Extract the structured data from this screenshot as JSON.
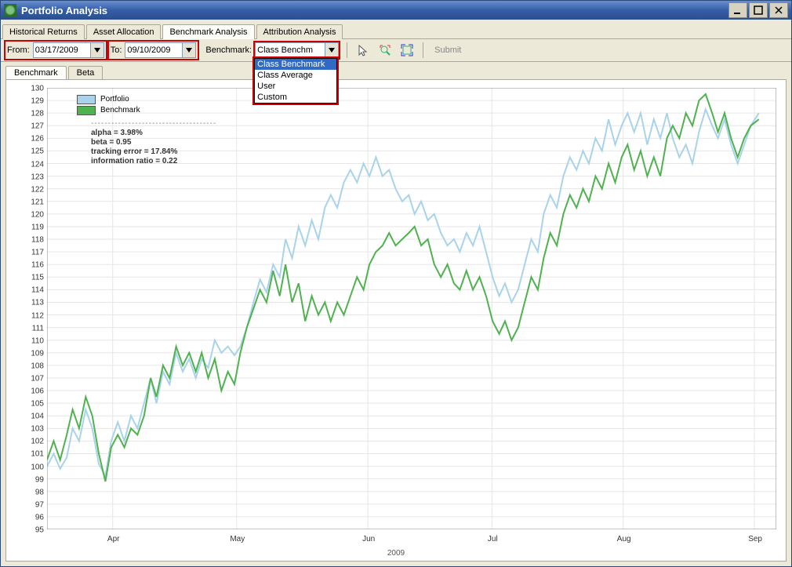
{
  "window": {
    "title": "Portfolio Analysis"
  },
  "tabs": {
    "items": [
      {
        "label": "Historical Returns"
      },
      {
        "label": "Asset Allocation"
      },
      {
        "label": "Benchmark Analysis"
      },
      {
        "label": "Attribution Analysis"
      }
    ],
    "active": 2
  },
  "toolbar": {
    "from_label": "From:",
    "from_value": "03/17/2009",
    "to_label": "To:",
    "to_value": "09/10/2009",
    "benchmark_label": "Benchmark:",
    "benchmark_value": "Class Benchm",
    "benchmark_options": [
      "Class Benchmark",
      "Class Average",
      "User",
      "Custom"
    ],
    "submit_label": "Submit"
  },
  "subtabs": {
    "items": [
      {
        "label": "Benchmark"
      },
      {
        "label": "Beta"
      }
    ],
    "active": 0
  },
  "legend": {
    "portfolio": {
      "label": "Portfolio",
      "color": "#a9d3ea"
    },
    "benchmark": {
      "label": "Benchmark",
      "color": "#4fb24f"
    }
  },
  "stats": {
    "lines": [
      "alpha = 3.98%",
      "beta = 0.95",
      "tracking error = 17.84%",
      "information ratio = 0.22"
    ]
  },
  "chart_data": {
    "type": "line",
    "title": "",
    "xlabel": "2009",
    "ylabel": "",
    "ylim": [
      95,
      130
    ],
    "yticks": [
      95,
      96,
      97,
      98,
      99,
      100,
      101,
      102,
      103,
      104,
      105,
      106,
      107,
      108,
      109,
      110,
      111,
      112,
      113,
      114,
      115,
      116,
      117,
      118,
      119,
      120,
      121,
      122,
      123,
      124,
      125,
      126,
      127,
      128,
      129,
      130
    ],
    "x_categories": [
      "Apr",
      "May",
      "Jun",
      "Jul",
      "Aug",
      "Sep"
    ],
    "x_positions_pct": [
      9,
      26,
      44,
      61,
      79,
      97
    ],
    "series": [
      {
        "name": "Portfolio",
        "color": "#a9d3ea",
        "points": [
          [
            0.0,
            100.0
          ],
          [
            0.9,
            101.0
          ],
          [
            1.8,
            99.8
          ],
          [
            2.7,
            100.7
          ],
          [
            3.5,
            103.0
          ],
          [
            4.4,
            102.0
          ],
          [
            5.3,
            104.5
          ],
          [
            6.2,
            103.0
          ],
          [
            7.1,
            100.2
          ],
          [
            8.0,
            99.2
          ],
          [
            8.8,
            102.0
          ],
          [
            9.7,
            103.5
          ],
          [
            10.6,
            102.0
          ],
          [
            11.5,
            104.0
          ],
          [
            12.4,
            103.0
          ],
          [
            13.3,
            105.0
          ],
          [
            14.2,
            107.0
          ],
          [
            15.0,
            105.0
          ],
          [
            15.9,
            107.5
          ],
          [
            16.8,
            106.5
          ],
          [
            17.7,
            109.0
          ],
          [
            18.6,
            107.5
          ],
          [
            19.5,
            108.5
          ],
          [
            20.4,
            107.0
          ],
          [
            21.2,
            108.5
          ],
          [
            22.1,
            107.8
          ],
          [
            23.0,
            110.0
          ],
          [
            23.9,
            109.0
          ],
          [
            24.8,
            109.5
          ],
          [
            25.7,
            108.8
          ],
          [
            26.5,
            109.5
          ],
          [
            27.4,
            111.0
          ],
          [
            28.3,
            113.0
          ],
          [
            29.2,
            114.8
          ],
          [
            30.1,
            113.8
          ],
          [
            31.0,
            116.0
          ],
          [
            31.9,
            115.0
          ],
          [
            32.7,
            118.0
          ],
          [
            33.6,
            116.5
          ],
          [
            34.5,
            119.0
          ],
          [
            35.4,
            117.5
          ],
          [
            36.3,
            119.5
          ],
          [
            37.2,
            118.0
          ],
          [
            38.1,
            120.5
          ],
          [
            38.9,
            121.5
          ],
          [
            39.8,
            120.5
          ],
          [
            40.7,
            122.5
          ],
          [
            41.6,
            123.5
          ],
          [
            42.5,
            122.5
          ],
          [
            43.4,
            124.0
          ],
          [
            44.2,
            123.0
          ],
          [
            45.1,
            124.5
          ],
          [
            46.0,
            123.0
          ],
          [
            46.9,
            123.5
          ],
          [
            47.8,
            122.0
          ],
          [
            48.7,
            121.0
          ],
          [
            49.6,
            121.5
          ],
          [
            50.4,
            120.0
          ],
          [
            51.3,
            121.0
          ],
          [
            52.2,
            119.5
          ],
          [
            53.1,
            120.0
          ],
          [
            54.0,
            118.5
          ],
          [
            54.9,
            117.5
          ],
          [
            55.8,
            118.0
          ],
          [
            56.6,
            117.0
          ],
          [
            57.5,
            118.5
          ],
          [
            58.4,
            117.5
          ],
          [
            59.3,
            119.0
          ],
          [
            60.2,
            117.0
          ],
          [
            61.1,
            115.0
          ],
          [
            62.0,
            113.5
          ],
          [
            62.8,
            114.5
          ],
          [
            63.7,
            113.0
          ],
          [
            64.6,
            114.0
          ],
          [
            65.5,
            116.0
          ],
          [
            66.4,
            118.0
          ],
          [
            67.3,
            117.0
          ],
          [
            68.1,
            120.0
          ],
          [
            69.0,
            121.5
          ],
          [
            69.9,
            120.5
          ],
          [
            70.8,
            123.0
          ],
          [
            71.7,
            124.5
          ],
          [
            72.6,
            123.5
          ],
          [
            73.5,
            125.0
          ],
          [
            74.3,
            124.0
          ],
          [
            75.2,
            126.0
          ],
          [
            76.1,
            125.0
          ],
          [
            77.0,
            127.5
          ],
          [
            77.9,
            125.5
          ],
          [
            78.8,
            127.0
          ],
          [
            79.6,
            128.0
          ],
          [
            80.5,
            126.5
          ],
          [
            81.4,
            128.0
          ],
          [
            82.3,
            125.5
          ],
          [
            83.2,
            127.5
          ],
          [
            84.1,
            126.0
          ],
          [
            85.0,
            128.0
          ],
          [
            85.8,
            126.0
          ],
          [
            86.7,
            124.5
          ],
          [
            87.6,
            125.5
          ],
          [
            88.5,
            124.0
          ],
          [
            89.4,
            126.5
          ],
          [
            90.3,
            128.3
          ],
          [
            91.2,
            127.0
          ],
          [
            92.0,
            126.0
          ],
          [
            92.9,
            127.5
          ],
          [
            93.8,
            125.5
          ],
          [
            94.7,
            124.0
          ],
          [
            95.6,
            125.5
          ],
          [
            96.5,
            127.0
          ],
          [
            97.6,
            128.0
          ]
        ]
      },
      {
        "name": "Benchmark",
        "color": "#4fb24f",
        "points": [
          [
            0.0,
            100.5
          ],
          [
            0.9,
            102.0
          ],
          [
            1.8,
            100.5
          ],
          [
            2.7,
            102.5
          ],
          [
            3.5,
            104.5
          ],
          [
            4.4,
            103.0
          ],
          [
            5.3,
            105.5
          ],
          [
            6.2,
            104.0
          ],
          [
            7.1,
            101.0
          ],
          [
            8.0,
            98.8
          ],
          [
            8.8,
            101.5
          ],
          [
            9.7,
            102.5
          ],
          [
            10.6,
            101.5
          ],
          [
            11.5,
            103.0
          ],
          [
            12.4,
            102.5
          ],
          [
            13.3,
            104.0
          ],
          [
            14.2,
            107.0
          ],
          [
            15.0,
            105.5
          ],
          [
            15.9,
            108.0
          ],
          [
            16.8,
            107.0
          ],
          [
            17.7,
            109.5
          ],
          [
            18.6,
            108.0
          ],
          [
            19.5,
            109.0
          ],
          [
            20.4,
            107.5
          ],
          [
            21.2,
            109.0
          ],
          [
            22.1,
            107.0
          ],
          [
            23.0,
            108.5
          ],
          [
            23.9,
            106.0
          ],
          [
            24.8,
            107.5
          ],
          [
            25.7,
            106.5
          ],
          [
            26.5,
            109.0
          ],
          [
            27.4,
            111.0
          ],
          [
            28.3,
            112.5
          ],
          [
            29.2,
            114.0
          ],
          [
            30.1,
            113.0
          ],
          [
            31.0,
            115.5
          ],
          [
            31.9,
            113.5
          ],
          [
            32.7,
            116.0
          ],
          [
            33.6,
            113.0
          ],
          [
            34.5,
            114.5
          ],
          [
            35.4,
            111.5
          ],
          [
            36.3,
            113.5
          ],
          [
            37.2,
            112.0
          ],
          [
            38.1,
            113.0
          ],
          [
            38.9,
            111.5
          ],
          [
            39.8,
            113.0
          ],
          [
            40.7,
            112.0
          ],
          [
            41.6,
            113.5
          ],
          [
            42.5,
            115.0
          ],
          [
            43.4,
            114.0
          ],
          [
            44.2,
            116.0
          ],
          [
            45.1,
            117.0
          ],
          [
            46.0,
            117.5
          ],
          [
            46.9,
            118.5
          ],
          [
            47.8,
            117.5
          ],
          [
            48.7,
            118.0
          ],
          [
            49.6,
            118.5
          ],
          [
            50.4,
            119.0
          ],
          [
            51.3,
            117.5
          ],
          [
            52.2,
            118.0
          ],
          [
            53.1,
            116.0
          ],
          [
            54.0,
            115.0
          ],
          [
            54.9,
            116.0
          ],
          [
            55.8,
            114.5
          ],
          [
            56.6,
            114.0
          ],
          [
            57.5,
            115.5
          ],
          [
            58.4,
            114.0
          ],
          [
            59.3,
            115.0
          ],
          [
            60.2,
            113.5
          ],
          [
            61.1,
            111.5
          ],
          [
            62.0,
            110.5
          ],
          [
            62.8,
            111.5
          ],
          [
            63.7,
            110.0
          ],
          [
            64.6,
            111.0
          ],
          [
            65.5,
            113.0
          ],
          [
            66.4,
            115.0
          ],
          [
            67.3,
            114.0
          ],
          [
            68.1,
            116.5
          ],
          [
            69.0,
            118.5
          ],
          [
            69.9,
            117.5
          ],
          [
            70.8,
            120.0
          ],
          [
            71.7,
            121.5
          ],
          [
            72.6,
            120.5
          ],
          [
            73.5,
            122.0
          ],
          [
            74.3,
            121.0
          ],
          [
            75.2,
            123.0
          ],
          [
            76.1,
            122.0
          ],
          [
            77.0,
            124.0
          ],
          [
            77.9,
            122.5
          ],
          [
            78.8,
            124.5
          ],
          [
            79.6,
            125.5
          ],
          [
            80.5,
            123.5
          ],
          [
            81.4,
            125.0
          ],
          [
            82.3,
            123.0
          ],
          [
            83.2,
            124.5
          ],
          [
            84.1,
            123.0
          ],
          [
            85.0,
            126.0
          ],
          [
            85.8,
            127.0
          ],
          [
            86.7,
            126.0
          ],
          [
            87.6,
            128.0
          ],
          [
            88.5,
            127.0
          ],
          [
            89.4,
            129.0
          ],
          [
            90.3,
            129.5
          ],
          [
            91.2,
            128.0
          ],
          [
            92.0,
            126.5
          ],
          [
            92.9,
            128.0
          ],
          [
            93.8,
            126.0
          ],
          [
            94.7,
            124.5
          ],
          [
            95.6,
            126.0
          ],
          [
            96.5,
            127.0
          ],
          [
            97.6,
            127.5
          ]
        ]
      }
    ]
  }
}
